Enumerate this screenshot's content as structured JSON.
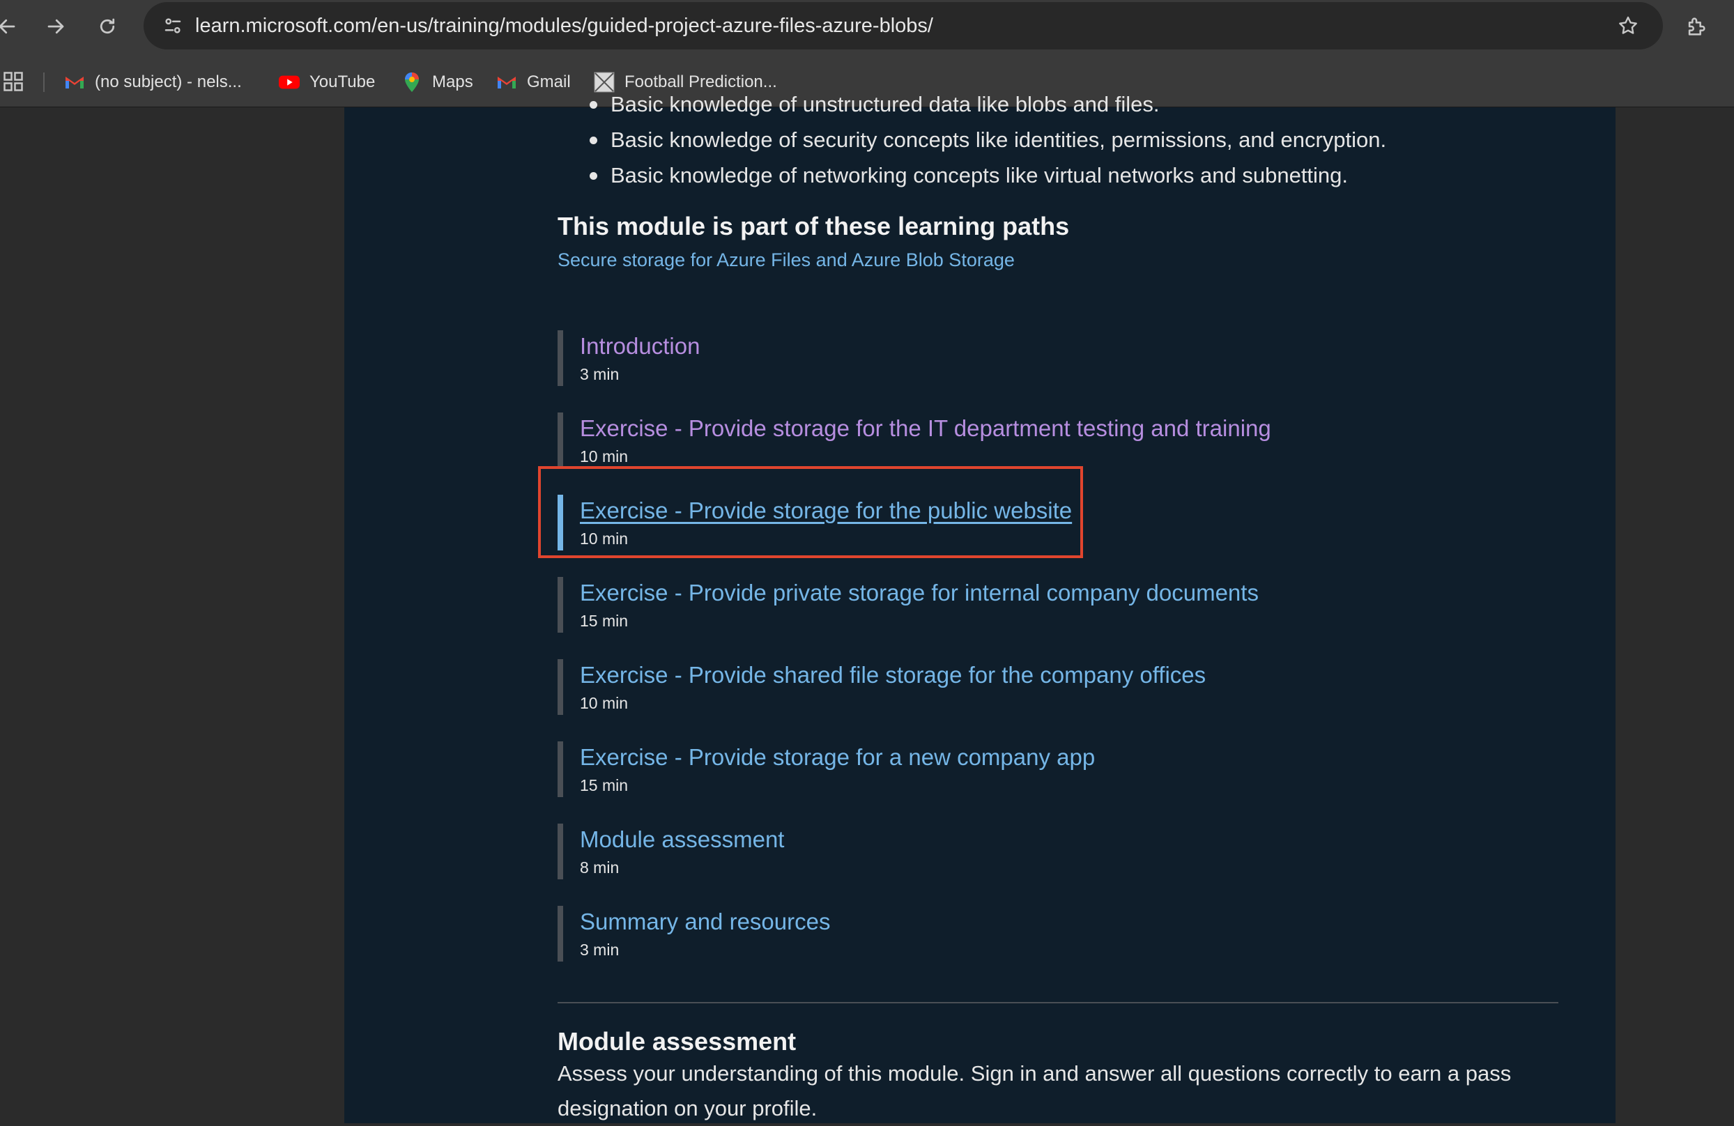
{
  "browser": {
    "url": "learn.microsoft.com/en-us/training/modules/guided-project-azure-files-azure-blobs/",
    "bookmarks": [
      {
        "label": "(no subject) - nels...",
        "icon": "gmail-icon"
      },
      {
        "label": "YouTube",
        "icon": "youtube-icon"
      },
      {
        "label": "Maps",
        "icon": "maps-icon"
      },
      {
        "label": "Gmail",
        "icon": "gmail-icon"
      },
      {
        "label": "Football Prediction...",
        "icon": "football-site-icon"
      }
    ],
    "colors": {
      "gmail_red": "#ea4335",
      "youtube_red": "#ff0000"
    }
  },
  "prerequisites": {
    "items": [
      "Basic knowledge of unstructured data like blobs and files.",
      "Basic knowledge of security concepts like identities, permissions, and encryption.",
      "Basic knowledge of networking concepts like virtual networks and subnetting."
    ]
  },
  "learning_paths": {
    "heading": "This module is part of these learning paths",
    "link": "Secure storage for Azure Files and Azure Blob Storage"
  },
  "units": [
    {
      "title": "Introduction",
      "duration": "3 min",
      "state": "visited"
    },
    {
      "title": "Exercise - Provide storage for the IT department testing and training",
      "duration": "10 min",
      "state": "visited"
    },
    {
      "title": "Exercise - Provide storage for the public website",
      "duration": "10 min",
      "state": "active"
    },
    {
      "title": "Exercise - Provide private storage for internal company documents",
      "duration": "15 min",
      "state": "default"
    },
    {
      "title": "Exercise - Provide shared file storage for the company offices",
      "duration": "10 min",
      "state": "default"
    },
    {
      "title": "Exercise - Provide storage for a new company app",
      "duration": "15 min",
      "state": "default"
    },
    {
      "title": "Module assessment",
      "duration": "8 min",
      "state": "default"
    },
    {
      "title": "Summary and resources",
      "duration": "3 min",
      "state": "default"
    }
  ],
  "module_assessment": {
    "heading": "Module assessment",
    "description": "Assess your understanding of this module. Sign in and answer all questions correctly to earn a pass designation on your profile."
  },
  "theme": {
    "page_bg": "#0f1e2b",
    "link_color": "#75b6e7",
    "visited_color": "#b78ee0",
    "highlight_color": "#e0452e"
  }
}
